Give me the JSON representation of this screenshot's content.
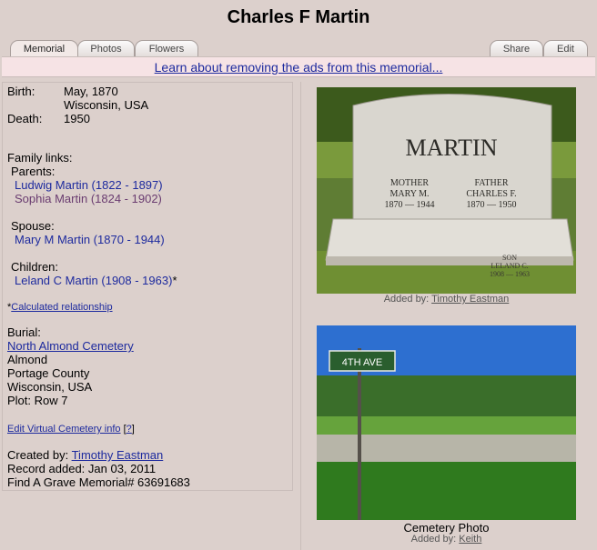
{
  "page": {
    "title": "Charles F Martin"
  },
  "tabs": {
    "memorial": "Memorial",
    "photos": "Photos",
    "flowers": "Flowers",
    "share": "Share",
    "edit": "Edit"
  },
  "ad": {
    "link": "Learn about removing the ads from this memorial..."
  },
  "birth": {
    "label": "Birth:",
    "date": "May, 1870",
    "place": "Wisconsin, USA"
  },
  "death": {
    "label": "Death:",
    "date": "1950"
  },
  "family": {
    "heading": "Family links:",
    "parents_label": "Parents:",
    "parents": [
      "Ludwig Martin (1822 - 1897)",
      "Sophia Martin (1824 - 1902)"
    ],
    "spouse_label": "Spouse:",
    "spouse": "Mary M Martin (1870 - 1944)",
    "children_label": "Children:",
    "child": "Leland C Martin (1908 - 1963)",
    "child_mark": "*",
    "calc_prefix": "*",
    "calc_link": "Calculated relationship"
  },
  "burial": {
    "label": "Burial:",
    "cemetery": "North Almond Cemetery",
    "town": "Almond",
    "county": "Portage County",
    "state": "Wisconsin, USA",
    "plot": "Plot: Row 7"
  },
  "virtual": {
    "link": "Edit Virtual Cemetery info",
    "help_open": "[",
    "help": "?",
    "help_close": "]"
  },
  "record": {
    "created_label": "Created by:",
    "creator": "Timothy Eastman",
    "added": "Record added: Jan 03, 2011",
    "memorial_id": "Find A Grave Memorial# 63691683"
  },
  "photos": {
    "headstone": {
      "surname": "MARTIN",
      "mother": "MOTHER",
      "mother_name": "MARY M.",
      "mother_years": "1870 — 1944",
      "father": "FATHER",
      "father_name": "CHARLES F.",
      "father_years": "1870 — 1950",
      "son": "SON",
      "son_name": "LELAND C.",
      "son_years": "1908 — 1963",
      "added_by_label": "Added by:",
      "added_by": "Timothy Eastman"
    },
    "cemetery": {
      "sign_text": "4TH AVE",
      "caption": "Cemetery Photo",
      "added_by_label": "Added by:",
      "added_by": "Keith"
    }
  }
}
